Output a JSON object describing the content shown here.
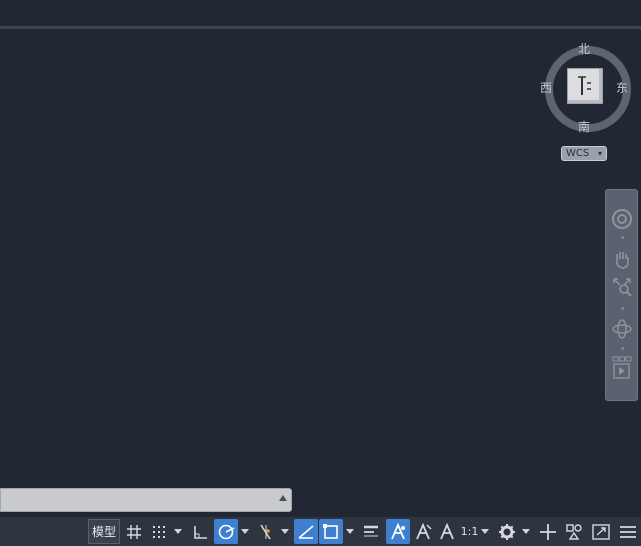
{
  "viewcube": {
    "north": "北",
    "south": "南",
    "west": "西",
    "east": "东",
    "face": "上",
    "wcs_label": "WCS"
  },
  "navbar": {
    "tools": [
      "steering-wheel-icon",
      "pan-hand-icon",
      "zoom-extents-icon",
      "orbit-icon",
      "showmotion-icon"
    ]
  },
  "command_line": {
    "value": "",
    "placeholder": ""
  },
  "statusbar": {
    "model_label": "模型",
    "scale_label": "1:1",
    "active_color": "#3f7fcf",
    "toggles": {
      "grid": false,
      "snap": false,
      "ortho": false,
      "polar": true,
      "isodraft": false,
      "osnap_track": false,
      "dyn_ucs": true,
      "osnap": true,
      "lineweight": false,
      "annotation_visibility": true
    }
  },
  "colors": {
    "viewport_bg": "#212733",
    "statusbar_bg": "#2e3440",
    "navbar_bg": "#5a6270"
  }
}
